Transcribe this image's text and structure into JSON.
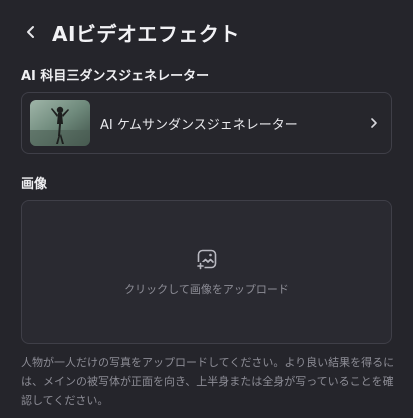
{
  "header": {
    "title": "AIビデオエフェクト",
    "back_icon": "chevron-left-icon"
  },
  "model_section": {
    "label": "AI 科目三ダンスジェネレーター",
    "selected_model": "AI ケムサンダンスジェネレーター",
    "chevron_icon": "chevron-right-icon"
  },
  "image_section": {
    "label": "画像",
    "upload_icon": "image-add-icon",
    "upload_text": "クリックして画像をアップロード"
  },
  "hint": "人物が一人だけの写真をアップロードしてください。より良い結果を得るには、メインの被写体が正面を向き、上半身または全身が写っていることを確認してください。",
  "colors": {
    "background": "#25252b",
    "border": "#3f3f48",
    "muted_text": "#8d8d96"
  }
}
